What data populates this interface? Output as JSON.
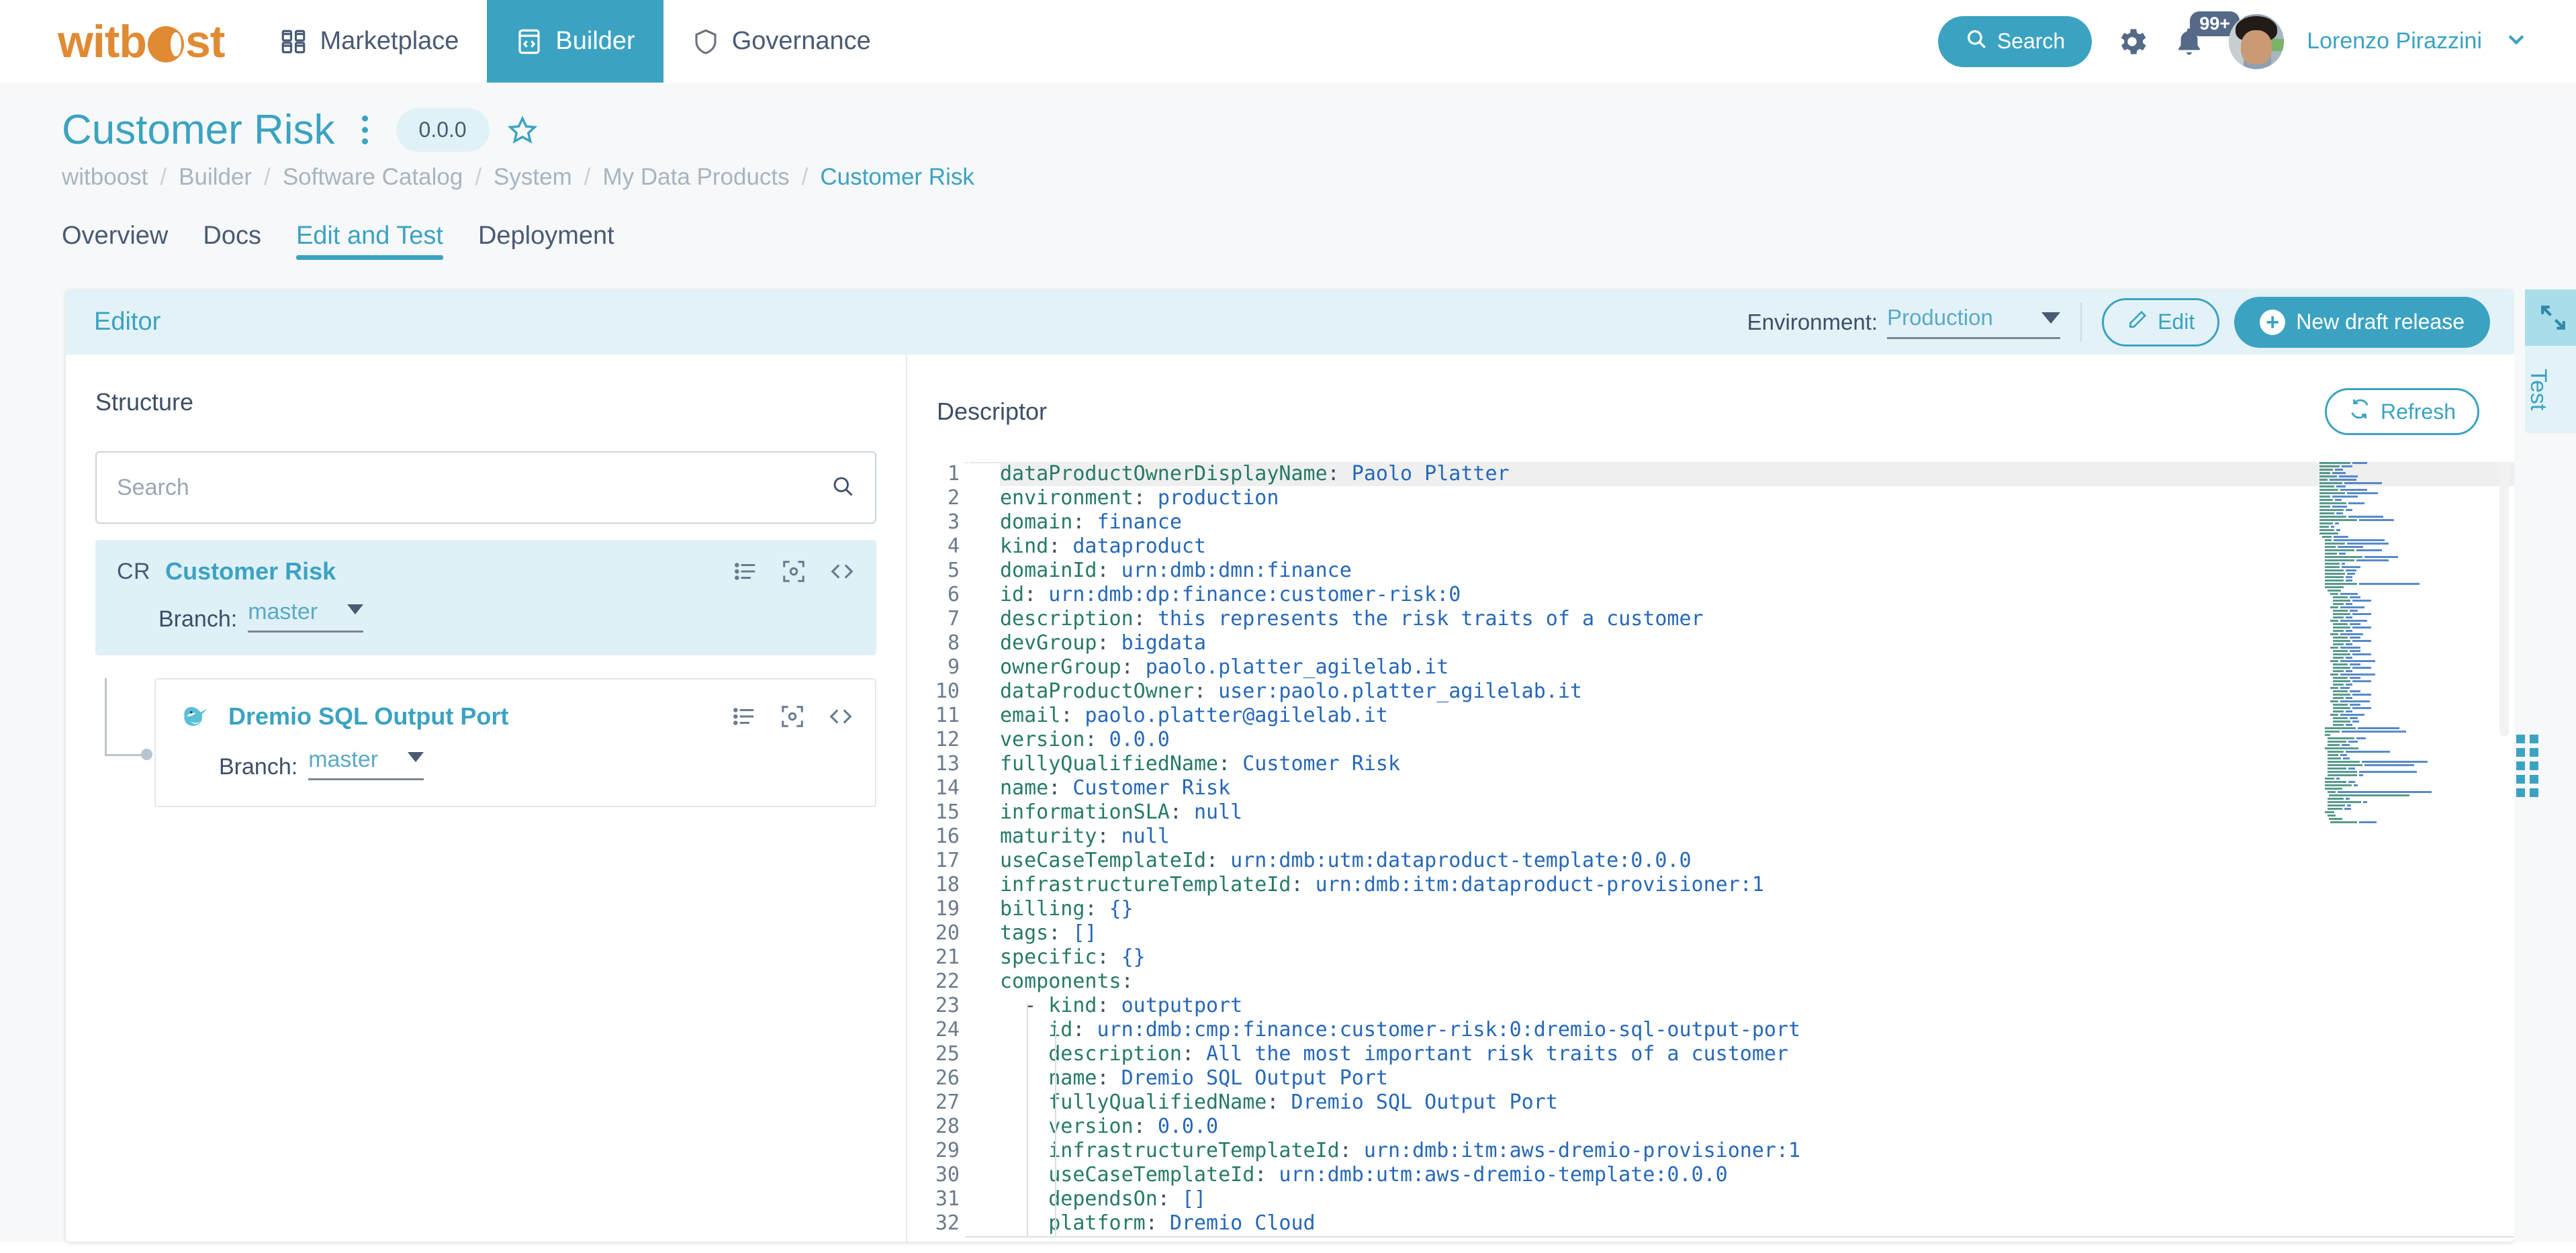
{
  "brand": {
    "name": "witboost",
    "color": "#e08a33",
    "accent": "#3ba3c1"
  },
  "topnav": {
    "items": [
      {
        "label": "Marketplace",
        "icon": "grid-icon",
        "active": false
      },
      {
        "label": "Builder",
        "icon": "code-window-icon",
        "active": true
      },
      {
        "label": "Governance",
        "icon": "shield-icon",
        "active": false
      }
    ],
    "search_label": "Search",
    "notifications_badge": "99+",
    "username": "Lorenzo Pirazzini"
  },
  "page": {
    "title": "Customer Risk",
    "version_badge": "0.0.0",
    "breadcrumb": [
      "witboost",
      "Builder",
      "Software Catalog",
      "System",
      "My Data Products",
      "Customer Risk"
    ],
    "breadcrumb_separator": "/",
    "tabs": [
      {
        "label": "Overview",
        "active": false
      },
      {
        "label": "Docs",
        "active": false
      },
      {
        "label": "Edit and Test",
        "active": true
      },
      {
        "label": "Deployment",
        "active": false
      }
    ]
  },
  "editor": {
    "title": "Editor",
    "environment_label": "Environment:",
    "environment_value": "Production",
    "edit_button": "Edit",
    "new_draft_button": "New draft release"
  },
  "structure": {
    "panel_title": "Structure",
    "search_placeholder": "Search",
    "search_value": "",
    "root": {
      "abbr": "CR",
      "name": "Customer Risk",
      "branch_label": "Branch:",
      "branch_value": "master"
    },
    "child": {
      "name": "Dremio SQL Output Port",
      "branch_label": "Branch:",
      "branch_value": "master"
    },
    "row_icons": [
      "list-icon",
      "focus-target-icon",
      "code-brackets-icon"
    ]
  },
  "descriptor": {
    "panel_title": "Descriptor",
    "refresh_button": "Refresh",
    "lines": [
      {
        "n": 1,
        "indent": 0,
        "key": "dataProductOwnerDisplayName",
        "value": "Paolo Platter",
        "highlight": true
      },
      {
        "n": 2,
        "indent": 0,
        "key": "environment",
        "value": "production"
      },
      {
        "n": 3,
        "indent": 0,
        "key": "domain",
        "value": "finance"
      },
      {
        "n": 4,
        "indent": 0,
        "key": "kind",
        "value": "dataproduct"
      },
      {
        "n": 5,
        "indent": 0,
        "key": "domainId",
        "value": "urn:dmb:dmn:finance"
      },
      {
        "n": 6,
        "indent": 0,
        "key": "id",
        "value": "urn:dmb:dp:finance:customer-risk:0"
      },
      {
        "n": 7,
        "indent": 0,
        "key": "description",
        "value": "this represents the risk traits of a customer"
      },
      {
        "n": 8,
        "indent": 0,
        "key": "devGroup",
        "value": "bigdata"
      },
      {
        "n": 9,
        "indent": 0,
        "key": "ownerGroup",
        "value": "paolo.platter_agilelab.it"
      },
      {
        "n": 10,
        "indent": 0,
        "key": "dataProductOwner",
        "value": "user:paolo.platter_agilelab.it"
      },
      {
        "n": 11,
        "indent": 0,
        "key": "email",
        "value": "paolo.platter@agilelab.it"
      },
      {
        "n": 12,
        "indent": 0,
        "key": "version",
        "value": "0.0.0"
      },
      {
        "n": 13,
        "indent": 0,
        "key": "fullyQualifiedName",
        "value": "Customer Risk"
      },
      {
        "n": 14,
        "indent": 0,
        "key": "name",
        "value": "Customer Risk"
      },
      {
        "n": 15,
        "indent": 0,
        "key": "informationSLA",
        "value": "null"
      },
      {
        "n": 16,
        "indent": 0,
        "key": "maturity",
        "value": "null"
      },
      {
        "n": 17,
        "indent": 0,
        "key": "useCaseTemplateId",
        "value": "urn:dmb:utm:dataproduct-template:0.0.0"
      },
      {
        "n": 18,
        "indent": 0,
        "key": "infrastructureTemplateId",
        "value": "urn:dmb:itm:dataproduct-provisioner:1"
      },
      {
        "n": 19,
        "indent": 0,
        "key": "billing",
        "value": "{}"
      },
      {
        "n": 20,
        "indent": 0,
        "key": "tags",
        "value": "[]"
      },
      {
        "n": 21,
        "indent": 0,
        "key": "specific",
        "value": "{}"
      },
      {
        "n": 22,
        "indent": 0,
        "key": "components",
        "value": ""
      },
      {
        "n": 23,
        "indent": 1,
        "dash": true,
        "key": "kind",
        "value": "outputport"
      },
      {
        "n": 24,
        "indent": 2,
        "key": "id",
        "value": "urn:dmb:cmp:finance:customer-risk:0:dremio-sql-output-port"
      },
      {
        "n": 25,
        "indent": 2,
        "key": "description",
        "value": "All the most important risk traits of a customer"
      },
      {
        "n": 26,
        "indent": 2,
        "key": "name",
        "value": "Dremio SQL Output Port"
      },
      {
        "n": 27,
        "indent": 2,
        "key": "fullyQualifiedName",
        "value": "Dremio SQL Output Port"
      },
      {
        "n": 28,
        "indent": 2,
        "key": "version",
        "value": "0.0.0"
      },
      {
        "n": 29,
        "indent": 2,
        "key": "infrastructureTemplateId",
        "value": "urn:dmb:itm:aws-dremio-provisioner:1"
      },
      {
        "n": 30,
        "indent": 2,
        "key": "useCaseTemplateId",
        "value": "urn:dmb:utm:aws-dremio-template:0.0.0"
      },
      {
        "n": 31,
        "indent": 2,
        "key": "dependsOn",
        "value": "[]"
      },
      {
        "n": 32,
        "indent": 2,
        "key": "platform",
        "value": "Dremio Cloud"
      }
    ]
  },
  "test_panel": {
    "label": "Test",
    "expand_icon": "expand-diagonal-icon"
  }
}
